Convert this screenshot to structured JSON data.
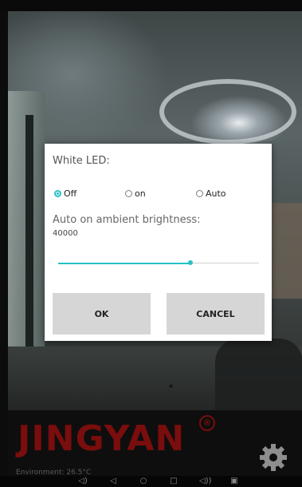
{
  "dialog": {
    "title": "White LED:",
    "options": [
      {
        "label": "Off",
        "checked": true
      },
      {
        "label": "on",
        "checked": false
      },
      {
        "label": "Auto",
        "checked": false
      }
    ],
    "ambient_label": "Auto on ambient brightness:",
    "ambient_value": "40000",
    "slider_fraction": 0.66,
    "ok_label": "OK",
    "cancel_label": "CANCEL",
    "accent_color": "#25c1c6"
  },
  "app": {
    "brand": "JINGYAN",
    "registered_mark": "®",
    "environment": "Environment: 26.5°C",
    "brand_color": "#7a0d0d",
    "settings_icon": "gear-icon"
  },
  "navbar": {
    "icons": [
      "volume-down-icon",
      "back-icon",
      "home-icon",
      "recents-icon",
      "volume-up-icon",
      "screenshot-icon"
    ]
  }
}
